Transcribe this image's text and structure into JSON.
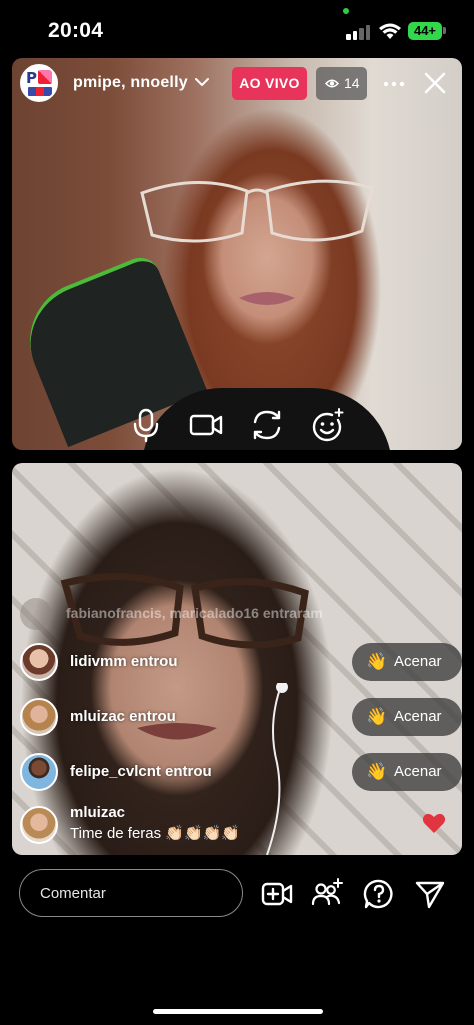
{
  "status_bar": {
    "time": "20:04",
    "battery": "44+",
    "battery_color": "#32d74b"
  },
  "header": {
    "title": "pmipe, nnoelly",
    "live_label": "AO VIVO",
    "live_color": "#e8345a",
    "viewer_count": "14",
    "icons": [
      "chevron-down-icon",
      "eye-icon",
      "more-icon",
      "close-icon"
    ]
  },
  "controls": {
    "icons": [
      "microphone-icon",
      "video-camera-icon",
      "switch-camera-icon",
      "effects-icon"
    ]
  },
  "feed": {
    "faded_join": "fabianofrancis, maricalado16 entraram",
    "joins": [
      {
        "text": "lidivmm entrou",
        "button": "Acenar"
      },
      {
        "text": "mluizac entrou",
        "button": "Acenar"
      },
      {
        "text": "felipe_cvlcnt entrou",
        "button": "Acenar"
      }
    ],
    "comment": {
      "user": "mluizac",
      "text": "Time de feras 👏🏻👏🏻👏🏻👏🏻"
    }
  },
  "bottom_bar": {
    "comment_placeholder": "Comentar",
    "icons": [
      "add-video-icon",
      "add-guest-icon",
      "question-icon",
      "send-icon"
    ]
  }
}
